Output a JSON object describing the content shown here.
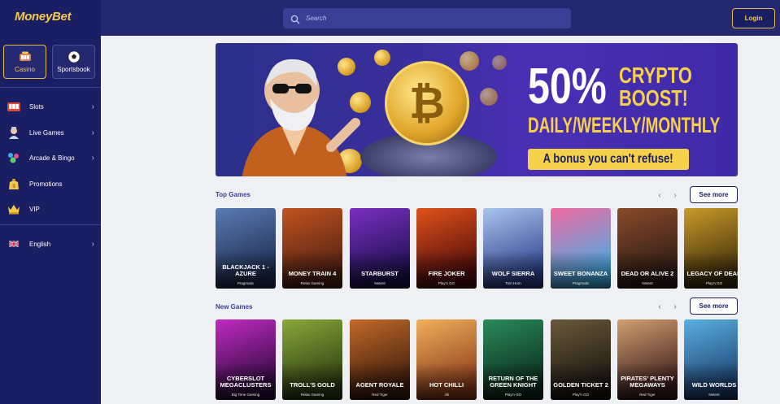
{
  "brand": {
    "logo_text": "MoneyBet"
  },
  "sidebar": {
    "modes": [
      {
        "label": "Casino",
        "icon": "casino-icon"
      },
      {
        "label": "Sportsbook",
        "icon": "soccer-ball-icon"
      }
    ],
    "items": [
      {
        "label": "Slots",
        "icon": "slot-machine-icon"
      },
      {
        "label": "Live Games",
        "icon": "dealer-icon"
      },
      {
        "label": "Arcade & Bingo",
        "icon": "arcade-icon"
      },
      {
        "label": "Promotions",
        "icon": "gift-bag-icon"
      },
      {
        "label": "VIP",
        "icon": "vip-icon"
      }
    ],
    "language": {
      "label": "English",
      "icon": "uk-flag-icon"
    }
  },
  "header": {
    "search_placeholder": "Search",
    "login_label": "Login"
  },
  "banner": {
    "percent": "50%",
    "line1": "CRYPTO",
    "line2": "BOOST!",
    "line3": "DAILY/WEEKLY/MONTHLY",
    "tagline": "A bonus you can't refuse!"
  },
  "sections": [
    {
      "title": "Top Games",
      "see_more": "See more",
      "games": [
        {
          "name": "Blackjack 1 - Azure",
          "provider": "Pragmatic",
          "color1": "#1b2a4a",
          "color2": "#5a7bb5"
        },
        {
          "name": "Money Train 4",
          "provider": "Relax Gaming",
          "color1": "#4a1f12",
          "color2": "#c2531f"
        },
        {
          "name": "Starburst",
          "provider": "Netent",
          "color1": "#1a0f4a",
          "color2": "#7a2fc2"
        },
        {
          "name": "Fire Joker",
          "provider": "Play'n GO",
          "color1": "#4a0a0a",
          "color2": "#e0521a"
        },
        {
          "name": "Wolf Sierra",
          "provider": "Tom Horn",
          "color1": "#2b3f8a",
          "color2": "#a9c4ee"
        },
        {
          "name": "Sweet Bonanza",
          "provider": "Pragmatic",
          "color1": "#3fb0e8",
          "color2": "#f06aa0"
        },
        {
          "name": "Dead or Alive 2",
          "provider": "Netent",
          "color1": "#2a1a14",
          "color2": "#8a4a2a"
        },
        {
          "name": "Legacy of Dead",
          "provider": "Play'n GO",
          "color1": "#3a2a08",
          "color2": "#c99a2a"
        }
      ]
    },
    {
      "title": "New Games",
      "see_more": "See more",
      "games": [
        {
          "name": "Cyberslot Megaclusters",
          "provider": "Big Time Gaming",
          "color1": "#2a0a3a",
          "color2": "#c02ac2"
        },
        {
          "name": "Troll's Gold",
          "provider": "Relax Gaming",
          "color1": "#2a3a10",
          "color2": "#8aa83a"
        },
        {
          "name": "Agent Royale",
          "provider": "Red Tiger",
          "color1": "#3a1a0a",
          "color2": "#c26a2a"
        },
        {
          "name": "Hot Chilli",
          "provider": "Jili",
          "color1": "#8a3a1a",
          "color2": "#f0b05a"
        },
        {
          "name": "Return of the Green Knight",
          "provider": "Play'n GO",
          "color1": "#0a2a1a",
          "color2": "#2a8a5a"
        },
        {
          "name": "Golden Ticket 2",
          "provider": "Play'n GO",
          "color1": "#1a1410",
          "color2": "#6a5a3a"
        },
        {
          "name": "Pirates' Plenty Megaways",
          "provider": "Red Tiger",
          "color1": "#3a1a1a",
          "color2": "#d0a070"
        },
        {
          "name": "Wild Worlds",
          "provider": "Netent",
          "color1": "#1a3a6a",
          "color2": "#5ab0e0"
        }
      ]
    }
  ],
  "colors": {
    "sidebar": "#1a1e63",
    "topbar": "#23286f",
    "accent_gold": "#f2c94c",
    "page_bg": "#eef0f4"
  }
}
